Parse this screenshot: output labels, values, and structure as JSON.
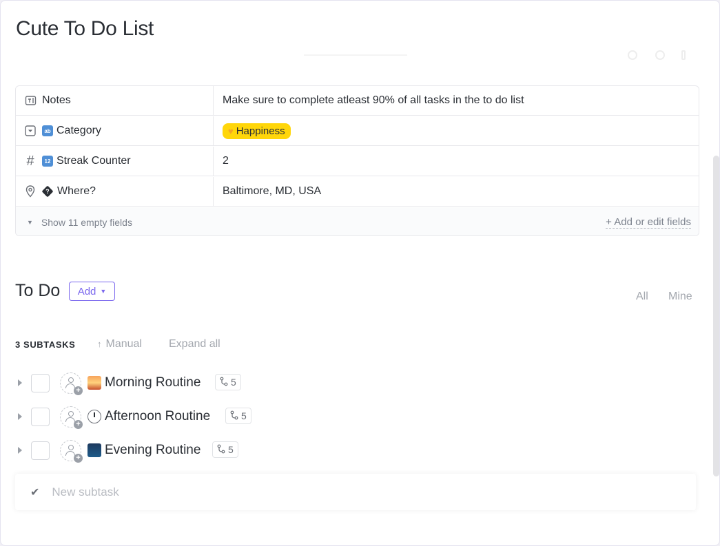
{
  "task": {
    "title": "Cute To Do List"
  },
  "fields": [
    {
      "icon": "notes-icon",
      "name": "Notes",
      "value": "Make sure to complete atleast 90% of all tasks in the to do list"
    },
    {
      "icon": "dropdown-icon",
      "emoji": "abcd-emoji",
      "name": "Category",
      "value": "Happiness",
      "value_emoji": "yellow-heart",
      "pill_color": "#ffd60a"
    },
    {
      "icon": "hash-icon",
      "emoji": "1234-emoji",
      "name": "Streak Counter",
      "value": "2"
    },
    {
      "icon": "location-pin-icon",
      "emoji": "unknown-glyph",
      "name": "Where?",
      "value": "Baltimore, MD, USA"
    }
  ],
  "fields_footer": {
    "show_empty": "Show 11 empty fields",
    "add_edit": "+ Add or edit fields"
  },
  "todo": {
    "heading": "To Do",
    "add_label": "Add",
    "filters": [
      "All",
      "Mine"
    ],
    "subtask_count_label": "3 SUBTASKS",
    "sort_label": "Manual",
    "expand_label": "Expand all",
    "subtasks": [
      {
        "name": "Morning Routine",
        "emoji": "sunrise-emoji",
        "count": "5"
      },
      {
        "name": "Afternoon Routine",
        "emoji": "clock-emoji",
        "count": "5"
      },
      {
        "name": "Evening Routine",
        "emoji": "city-night-emoji",
        "count": "5"
      }
    ],
    "new_subtask_placeholder": "New subtask"
  },
  "colors": {
    "accent": "#7b68ee",
    "pill": "#ffd60a",
    "text": "#2a2e34",
    "muted": "#a3a7ae"
  }
}
